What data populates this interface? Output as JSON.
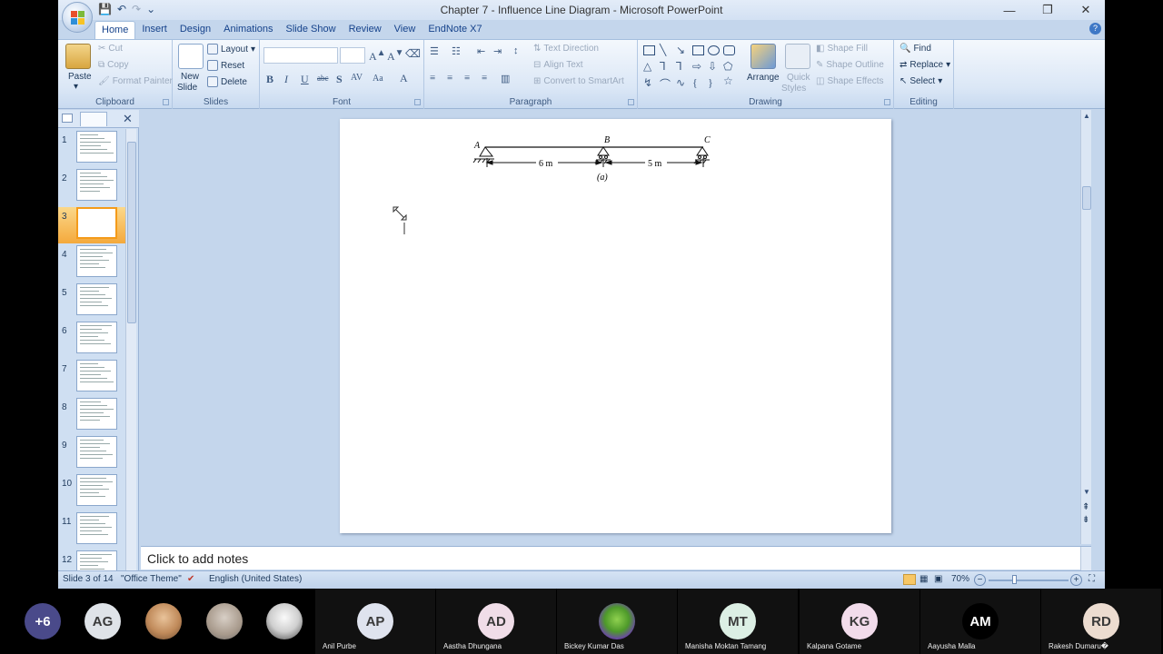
{
  "window": {
    "title": "Chapter 7 - Influence Line Diagram - Microsoft PowerPoint",
    "controls": {
      "minimize": "—",
      "restore": "❐",
      "close": "✕"
    }
  },
  "tabs": [
    "Home",
    "Insert",
    "Design",
    "Animations",
    "Slide Show",
    "Review",
    "View",
    "EndNote X7"
  ],
  "ribbon": {
    "clipboard": {
      "label": "Clipboard",
      "paste": "Paste",
      "cut": "Cut",
      "copy": "Copy",
      "format_painter": "Format Painter"
    },
    "slides": {
      "label": "Slides",
      "new_slide": "New",
      "new_slide2": "Slide",
      "layout": "Layout",
      "reset": "Reset",
      "delete": "Delete"
    },
    "font": {
      "label": "Font"
    },
    "paragraph": {
      "label": "Paragraph",
      "text_direction": "Text Direction",
      "align_text": "Align Text",
      "convert": "Convert to SmartArt"
    },
    "drawing": {
      "label": "Drawing",
      "arrange": "Arrange",
      "quick": "Quick",
      "styles": "Styles",
      "shape_fill": "Shape Fill",
      "shape_outline": "Shape Outline",
      "shape_effects": "Shape Effects"
    },
    "editing": {
      "label": "Editing",
      "find": "Find",
      "replace": "Replace",
      "select": "Select"
    }
  },
  "thumbnails": [
    "1",
    "2",
    "3",
    "4",
    "5",
    "6",
    "7",
    "8",
    "9",
    "10",
    "11",
    "12"
  ],
  "selected_slide": 3,
  "slide": {
    "label_a": "A",
    "label_b": "B",
    "label_c": "C",
    "span1": "6 m",
    "span2": "5 m",
    "caption": "(a)"
  },
  "notes_placeholder": "Click to add notes",
  "status": {
    "slide_of": "Slide 3 of 14",
    "theme": "\"Office Theme\"",
    "language": "English (United States)",
    "zoom": "70%"
  },
  "participants": {
    "more": "+6",
    "top_row": [
      {
        "initials": "AG",
        "color": "#dfe3e8"
      },
      {
        "initials": "AP",
        "name": "Anil Purbe",
        "color": "#dfe3ee"
      },
      {
        "initials": "AD",
        "name": "Aastha Dhungana",
        "color": "#f0dde8"
      },
      {
        "initials": "",
        "name": "Bickey Kumar Das",
        "color": "#7c4fb8"
      },
      {
        "initials": "MT",
        "name": "Manisha Moktan Tamang",
        "color": "#dcefe4"
      },
      {
        "initials": "KG",
        "name": "Kalpana Gotame",
        "color": "#f2dceb"
      },
      {
        "initials": "AM",
        "name": "Aayusha Malla",
        "color": "#000000"
      },
      {
        "initials": "RD",
        "name": "Rakesh Dumaru�",
        "color": "#ecdcd0"
      }
    ]
  }
}
